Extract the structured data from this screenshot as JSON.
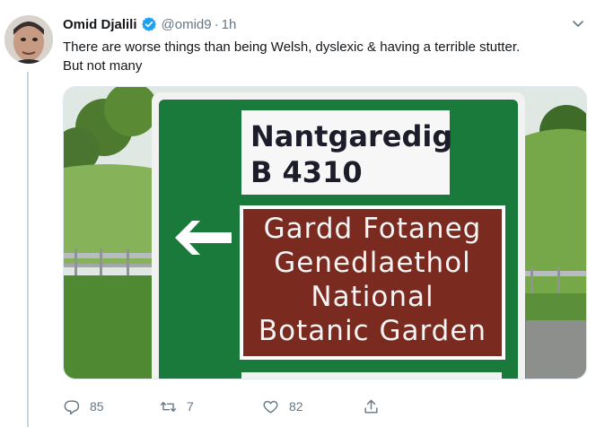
{
  "tweet": {
    "author_name": "Omid Djalili",
    "handle": "@omid9",
    "separator": "·",
    "time": "1h",
    "text_line1": "There are worse things than being Welsh, dyslexic & having a terrible stutter.",
    "text_line2": "But not many"
  },
  "sign": {
    "top_panel_line1": "Nantgaredig",
    "top_panel_line2": "B 4310",
    "bottom_panel_line1": "Gardd Fotaneg",
    "bottom_panel_line2": "Genedlaethol",
    "bottom_panel_line3": "National",
    "bottom_panel_line4": "Botanic Garden"
  },
  "actions": {
    "reply_count": "85",
    "retweet_count": "7",
    "like_count": "82"
  },
  "colors": {
    "sign_green": "#1a7a3c",
    "sign_brown": "#7a2a1f",
    "verified_blue": "#1da1f2",
    "muted_gray": "#657786"
  },
  "icons": [
    "verified-badge-icon",
    "chevron-down-icon",
    "reply-icon",
    "retweet-icon",
    "like-icon",
    "share-icon"
  ]
}
